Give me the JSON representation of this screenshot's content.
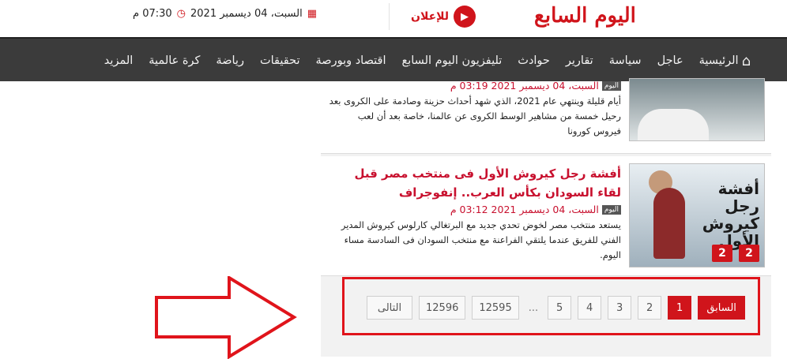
{
  "header": {
    "logo_text": "اليوم السابع",
    "ads_label": "للإعلان",
    "date": "السبت، 04 ديسمبر 2021",
    "time": "07:30 م"
  },
  "nav": {
    "items": [
      "الرئيسية",
      "عاجل",
      "سياسة",
      "تقارير",
      "حوادث",
      "تليفزيون اليوم السابع",
      "اقتصاد وبورصة",
      "تحقيقات",
      "رياضة",
      "كرة عالمية",
      "المزيد"
    ]
  },
  "articles": [
    {
      "source": "اليوم",
      "date": "السبت، 04 ديسمبر 2021 03:19 م",
      "excerpt": "أيام قليلة وينتهي عام 2021، الذي شهد أحداث حزينة وصادمة على الكروى بعد رحيل خمسة من مشاهير الوسط الكروى عن عالمنا، خاصة بعد أن لعب فيروس كورونا"
    },
    {
      "headline": "أفشة رجل كيروش الأول فى منتخب مصر قبل لقاء السودان بكأس العرب.. إنفوجراف",
      "source": "اليوم",
      "date": "السبت، 04 ديسمبر 2021 03:12 م",
      "excerpt": "يستعد منتخب مصر لخوض تحدي جديد مع البرتغالي كارلوس كيروش المدير الفني للفريق عندما يلتقي الفراعنة مع منتخب السودان فى السادسة مساء اليوم.",
      "thumb_text": "أفشة رجل كيروش الأول",
      "thumb_badges": [
        "2",
        "2"
      ]
    }
  ],
  "pagination": {
    "prev": "السابق",
    "pages": [
      "1",
      "2",
      "3",
      "4",
      "5"
    ],
    "dots": "...",
    "last_pages": [
      "12595",
      "12596"
    ],
    "next": "التالى",
    "active": "1"
  },
  "colors": {
    "accent": "#d0141b",
    "nav_bg": "#3b3b3b"
  }
}
